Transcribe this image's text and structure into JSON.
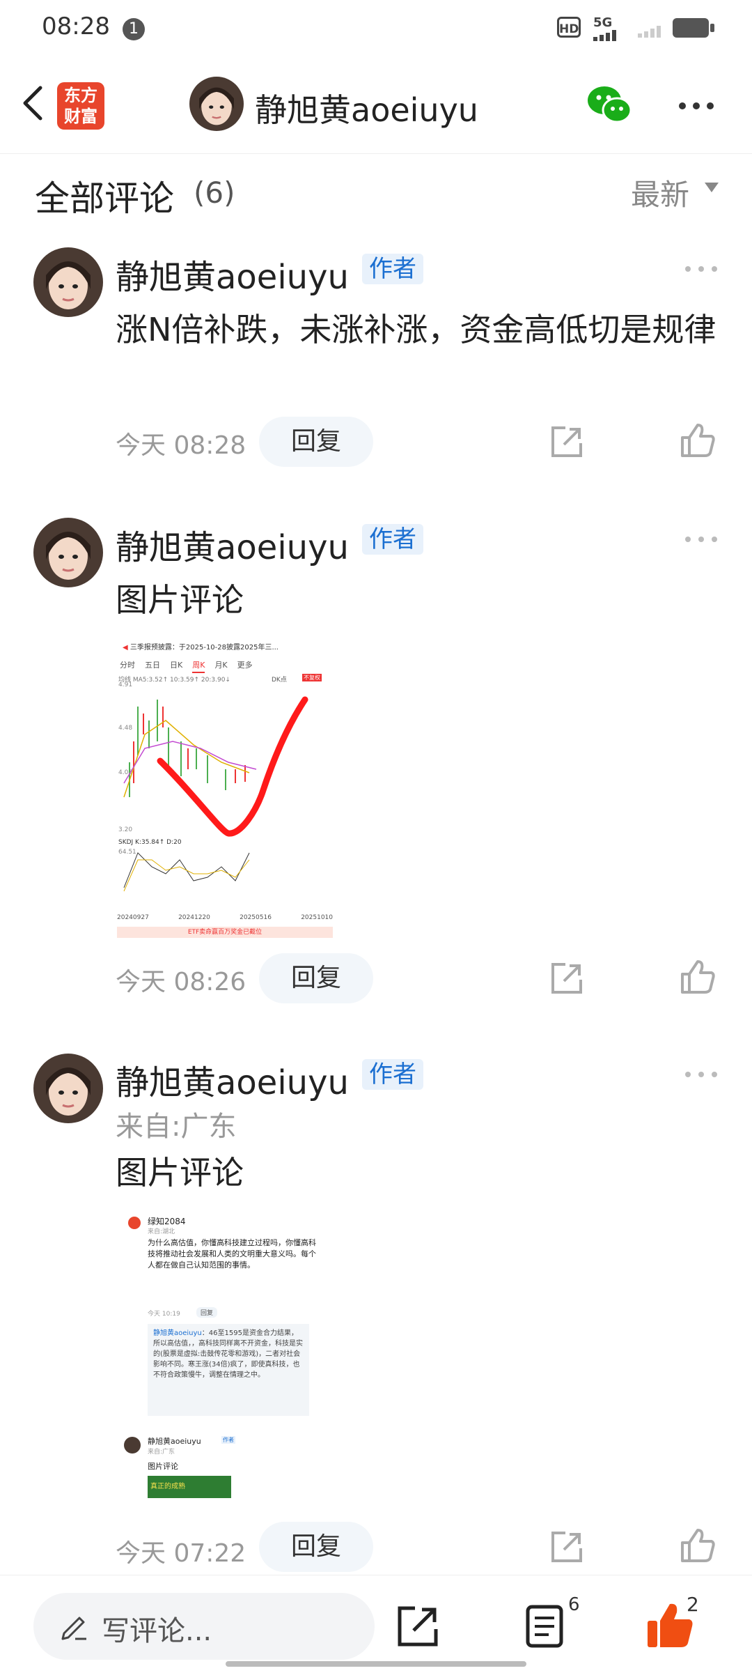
{
  "status_bar": {
    "time": "08:28",
    "notification_count": "1",
    "hd": "HD",
    "network": "5G"
  },
  "header": {
    "app_logo": "东方财富",
    "title": "静旭黄aoeiuyu"
  },
  "comments_header": {
    "title": "全部评论",
    "count": "(6)",
    "sort": "最新"
  },
  "comments": [
    {
      "author": "静旭黄aoeiuyu",
      "tag": "作者",
      "text": "涨N倍补跌，未涨补涨，资金高低切是规律",
      "time": "今天 08:28",
      "reply_label": "回复"
    },
    {
      "author": "静旭黄aoeiuyu",
      "tag": "作者",
      "text": "图片评论",
      "time": "今天 08:26",
      "reply_label": "回复",
      "image": {
        "banner": "三季报预披露：于2025-10-28披露2025年三...",
        "tabs": [
          "分时",
          "五日",
          "日K",
          "周K",
          "月K",
          "更多"
        ],
        "ma_line": "均线 MA5:3.52↑ 10:3.59↑ 20:3.90↓",
        "dk": "DK点",
        "no_adjust": "不复权",
        "y_labels": [
          "4.91",
          "4.48",
          "4.06",
          "3.20"
        ],
        "kdj_line": "SKDJ K:35.84↑ D:20",
        "kdj_label": "64.51",
        "dates": [
          "20240927",
          "20241220",
          "20250516",
          "20251010"
        ],
        "footer": "ETF卖命赢百万奖金已截位"
      }
    },
    {
      "author": "静旭黄aoeiuyu",
      "tag": "作者",
      "location": "来自:广东",
      "text": "图片评论",
      "time": "今天 07:22",
      "reply_label": "回复",
      "image": {
        "user": "绿知2084",
        "user_location": "来自:湖北",
        "text": "为什么高估值，你懂高科技建立过程吗，你懂高科技将推动社会发展和人类的文明重大意义吗。每个人都在做自己认知范围的事情。",
        "time": "今天 10:19",
        "reply": "回复",
        "quote_author": "静旭黄aoeiuyu",
        "quote_text": "：46至1595是资金合力结果，所以高估值，，高科技同样离不开资金，科技是实的(股票是虚拟:击鼓传花零和游戏)，二者对社会影响不同。寒王涨(34倍)疯了，即使真科技，也不符合政策慢牛，调整在情理之中。",
        "nested_author": "静旭黄aoeiuyu",
        "nested_tag": "作者",
        "nested_location": "来自:广东",
        "nested_text": "图片评论",
        "nested_image_text": "真正的成熟"
      }
    }
  ],
  "bottom_bar": {
    "placeholder": "写评论...",
    "list_count": "6",
    "like_count": "2"
  },
  "colors": {
    "accent": "#1b6fd1",
    "like_orange": "#f04e12",
    "brand_red": "#e8452c",
    "wechat_green": "#1aad19"
  }
}
